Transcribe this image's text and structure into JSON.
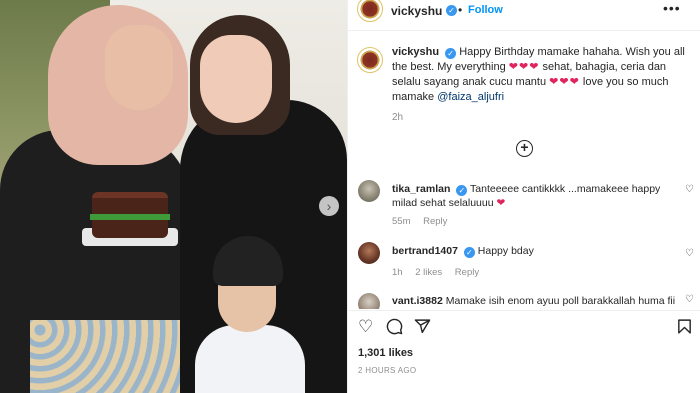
{
  "post": {
    "username": "vickyshu",
    "follow_label": "Follow",
    "separator": "•",
    "more_icon": "more-options-icon",
    "caption_text_a": "Happy Birthday mamake hahaha. Wish you all the best. My everything",
    "caption_hearts_a": "❤❤❤",
    "caption_text_b": "sehat, bahagia, ceria dan selalu sayang anak cucu mantu",
    "caption_hearts_b": "❤❤❤",
    "caption_text_c": "love you so much mamake",
    "caption_mention": "@faiza_aljufri",
    "caption_time": "2h",
    "load_more_icon": "plus-circle-icon",
    "likes": "1,301 likes",
    "posted": "2 HOURS AGO"
  },
  "comments": [
    {
      "username": "tika_ramlan",
      "verified": true,
      "text": "Tanteeeee cantikkkk ...mamakeee happy milad sehat selaluuuu",
      "hearts": "❤",
      "time": "55m",
      "reply": "Reply"
    },
    {
      "username": "bertrand1407",
      "verified": true,
      "text": "Happy bday",
      "time": "1h",
      "likes": "2 likes",
      "reply": "Reply"
    },
    {
      "username": "vant.i3882",
      "verified": false,
      "text": "Mamake isih enom ayuu poll barakkallah huma fii"
    }
  ],
  "colors": {
    "accent": "#0095f6",
    "verified": "#3897f0",
    "heart": "#e0245e",
    "muted": "#8e8e8e"
  }
}
